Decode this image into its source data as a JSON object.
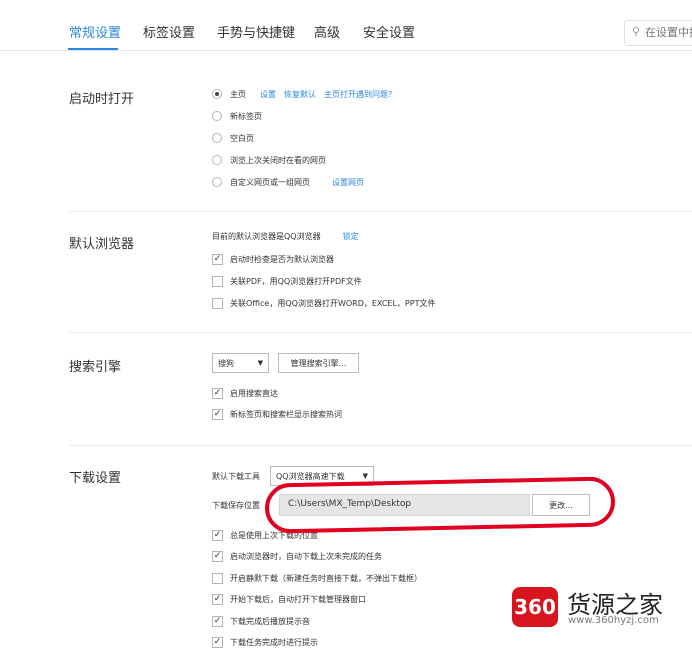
{
  "tabs": [
    {
      "label": "常规设置",
      "active": true
    },
    {
      "label": "标签设置",
      "active": false
    },
    {
      "label": "手势与快捷键",
      "active": false
    },
    {
      "label": "高级",
      "active": false
    },
    {
      "label": "安全设置",
      "active": false
    }
  ],
  "search": {
    "placeholder": "在设置中搜",
    "icon": "search-icon"
  },
  "startup": {
    "title": "启动时打开",
    "options": [
      {
        "label": "主页",
        "selected": true
      },
      {
        "label": "新标签页",
        "selected": false
      },
      {
        "label": "空白页",
        "selected": false
      },
      {
        "label": "浏览上次关闭时在看的网页",
        "selected": false
      },
      {
        "label": "自定义网页或一组网页",
        "selected": false
      }
    ],
    "home_links": [
      "设置",
      "恢复默认",
      "主页打开遇到问题?"
    ],
    "custom_link": "设置网页"
  },
  "default_browser": {
    "title": "默认浏览器",
    "status_text": "目前的默认浏览器是QQ浏览器",
    "lock_link": "锁定",
    "checks": [
      {
        "label": "启动时检查是否为默认浏览器",
        "checked": true
      },
      {
        "label": "关联PDF，用QQ浏览器打开PDF文件",
        "checked": false
      },
      {
        "label": "关联Office，用QQ浏览器打开WORD，EXCEL，PPT文件",
        "checked": false
      }
    ]
  },
  "search_engine": {
    "title": "搜索引擎",
    "selected": "搜狗",
    "manage_button": "管理搜索引擎...",
    "checks": [
      {
        "label": "启用搜索直达",
        "checked": true
      },
      {
        "label": "新标签页和搜索栏显示搜索热词",
        "checked": true
      }
    ]
  },
  "download": {
    "title": "下载设置",
    "tool_label": "默认下载工具",
    "tool_selected": "QQ浏览器高速下载",
    "path_label": "下载保存位置",
    "path_value": "C:\\Users\\MX_Temp\\Desktop",
    "change_button": "更改...",
    "checks": [
      {
        "label": "总是使用上次下载的位置",
        "checked": true
      },
      {
        "label": "启动浏览器时，自动下载上次未完成的任务",
        "checked": true
      },
      {
        "label": "开启静默下载（新建任务时直接下载，不弹出下载框）",
        "checked": false
      },
      {
        "label": "开始下载后，自动打开下载管理器窗口",
        "checked": true
      },
      {
        "label": "下载完成后播放提示音",
        "checked": true
      },
      {
        "label": "下载任务完成时进行提示",
        "checked": true
      }
    ]
  },
  "watermark": {
    "badge": "360",
    "title": "货源之家",
    "url": "www.360hyzj.com"
  },
  "colors": {
    "accent": "#2b86e0",
    "highlight": "#e0001f"
  }
}
